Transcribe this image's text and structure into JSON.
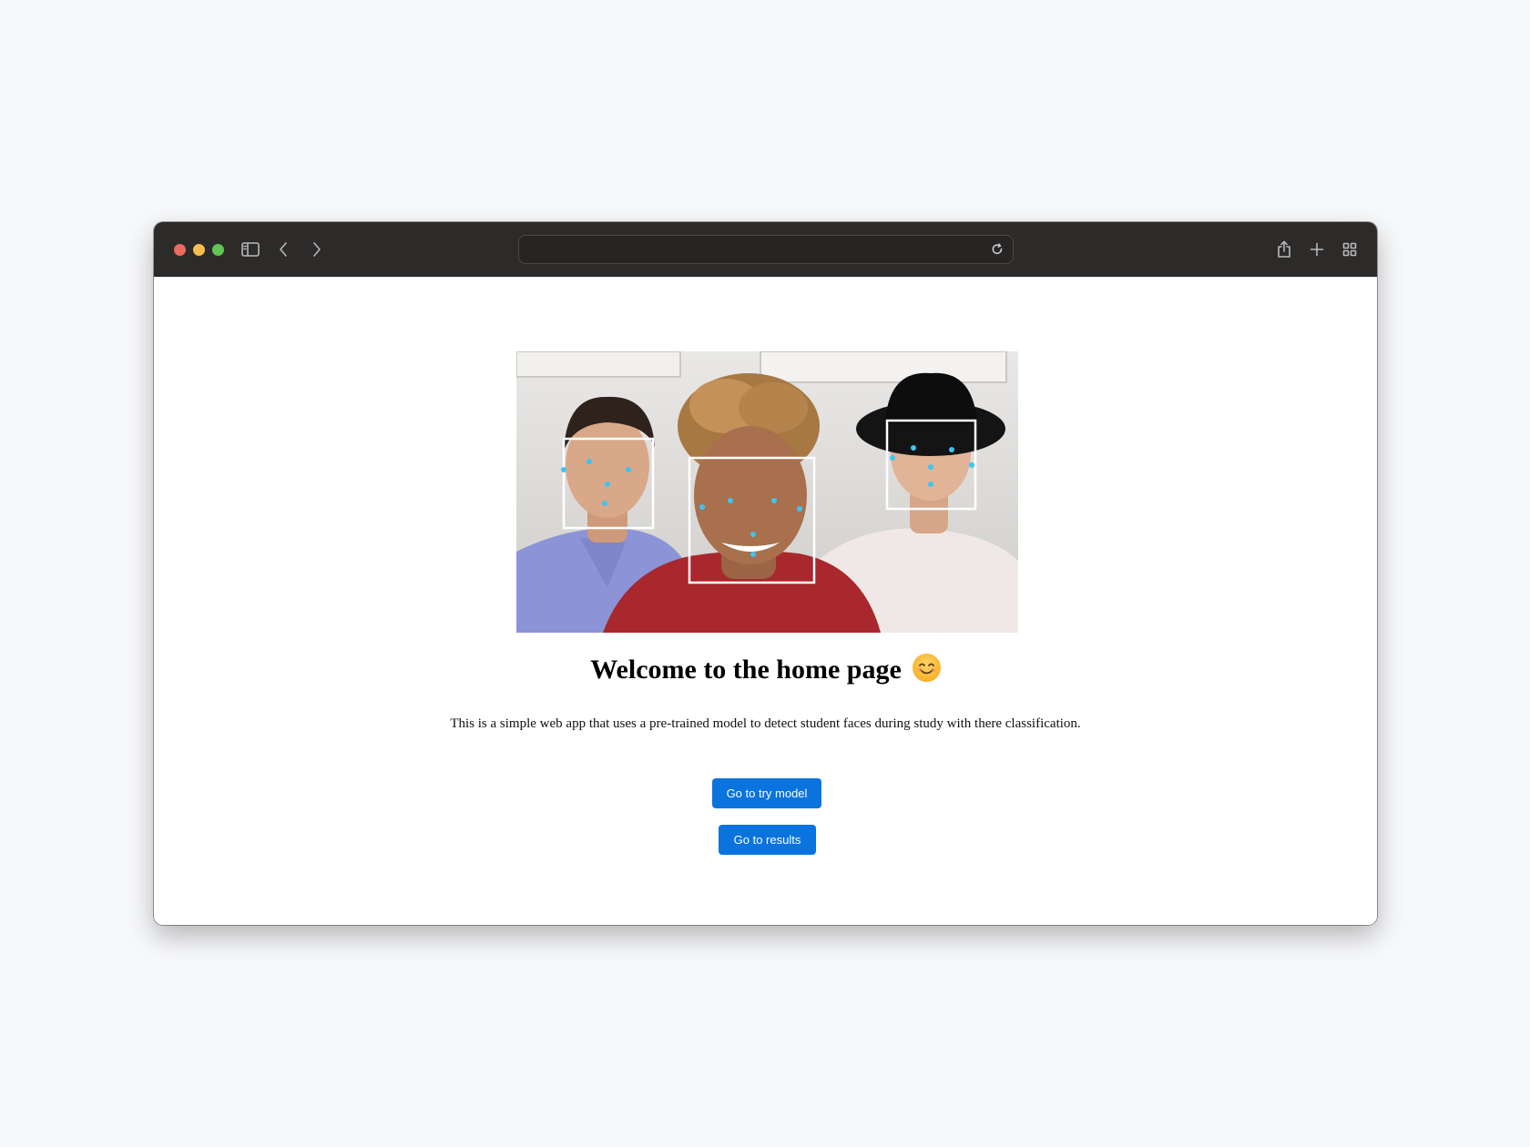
{
  "browser": {
    "url_value": "",
    "icons": [
      "sidebar-icon",
      "back-icon",
      "forward-icon",
      "reload-icon",
      "share-icon",
      "new-tab-icon",
      "tab-overview-icon"
    ]
  },
  "page": {
    "heading": "Welcome to the home page",
    "heading_emoji": "smiling-face",
    "description": "This is a simple web app that uses a pre-trained model to detect student faces during study with there classification.",
    "buttons": {
      "try_model": "Go to try model",
      "results": "Go to results"
    },
    "hero_image": {
      "faces_detected": 3,
      "box_color": "#ffffff",
      "landmark_color": "#3fc3f2"
    }
  },
  "colors": {
    "titlebar": "#2c2b2a",
    "button": "#0a73dd",
    "background": "#f7f8fa"
  }
}
